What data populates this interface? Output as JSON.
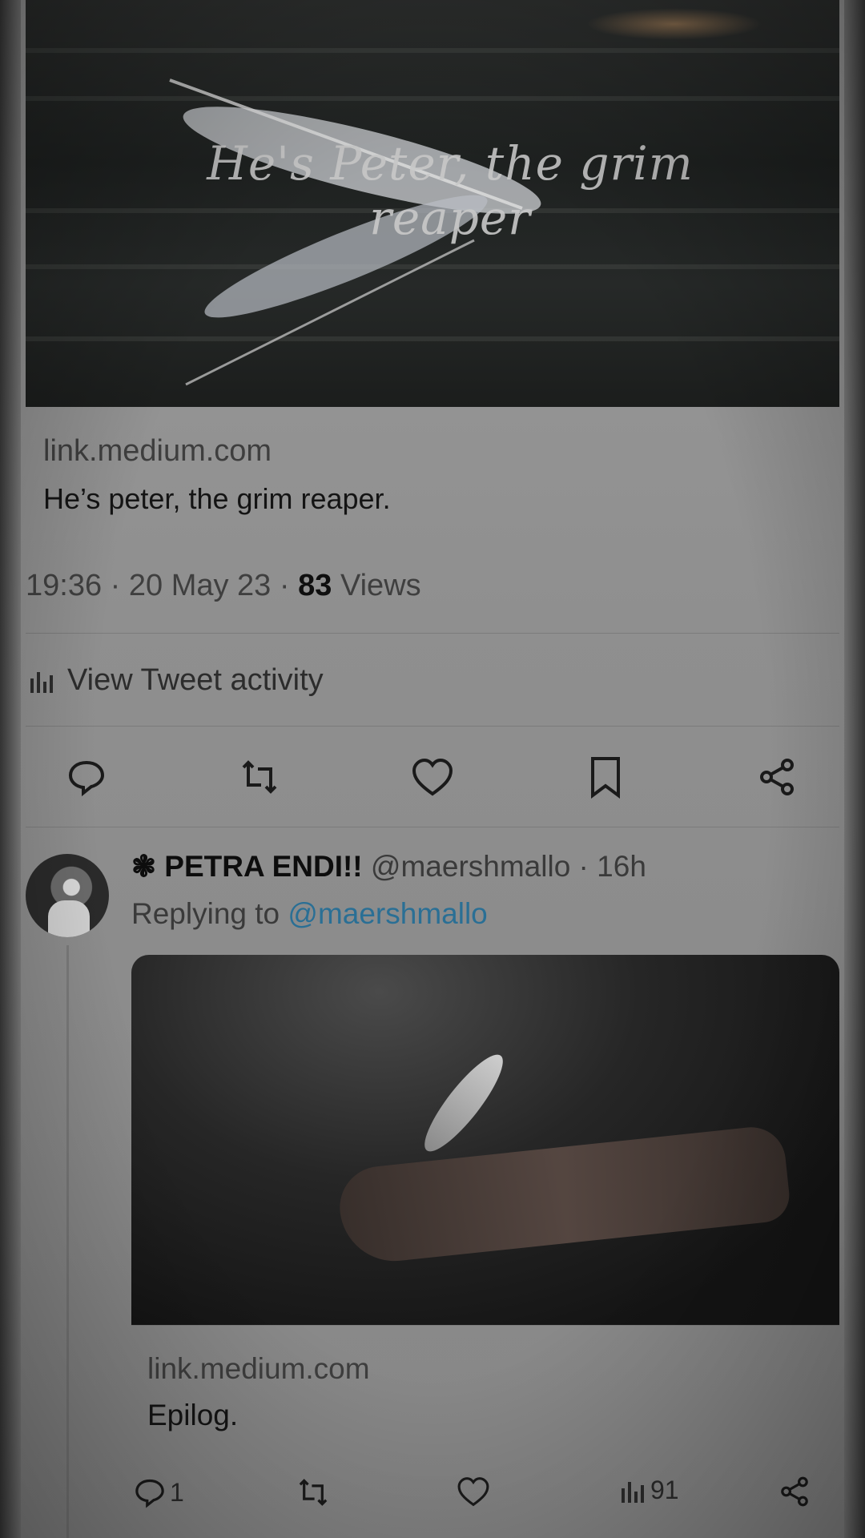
{
  "tweet": {
    "card": {
      "image_caption": "He's Peter, the grim reaper",
      "domain": "link.medium.com",
      "title": "He’s peter, the grim reaper."
    },
    "meta": {
      "time": "19:36",
      "date": "20 May 23",
      "views_count": "83",
      "views_label": "Views"
    },
    "activity_label": "View Tweet activity",
    "actions": [
      {
        "icon": "reply-icon"
      },
      {
        "icon": "retweet-icon"
      },
      {
        "icon": "like-icon"
      },
      {
        "icon": "bookmark-icon"
      },
      {
        "icon": "share-icon"
      }
    ]
  },
  "reply": {
    "display_name": "❃ PETRA ENDI!!",
    "handle": "@maershmallo",
    "time": "16h",
    "replying_prefix": "Replying to",
    "replying_to": "@maershmallo",
    "card": {
      "domain": "link.medium.com",
      "title": "Epilog."
    },
    "stats": {
      "replies": "1",
      "views": "91"
    }
  },
  "colors": {
    "mention": "#2a6f95",
    "background": "#8f8f8f"
  }
}
